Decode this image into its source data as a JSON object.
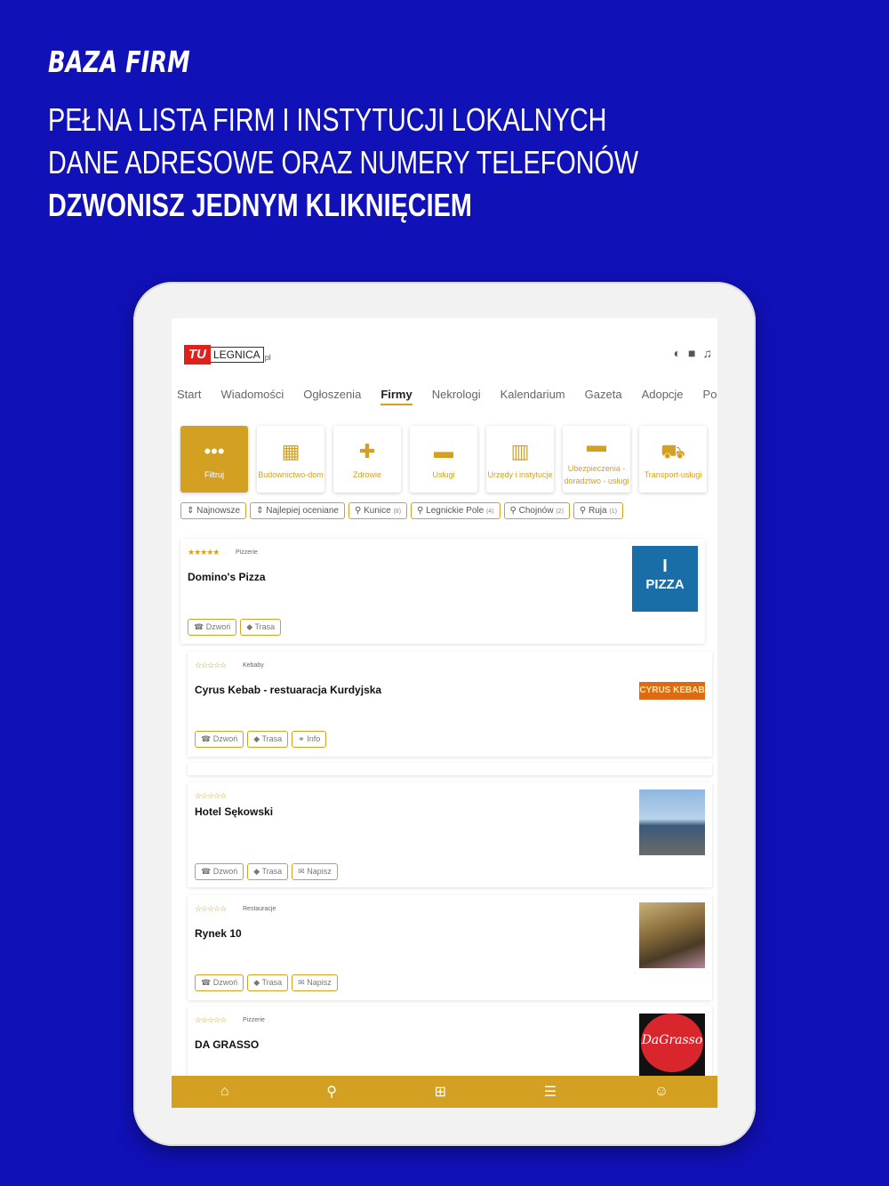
{
  "promo": {
    "title": "BAZA FIRM",
    "line1": "PEŁNA LISTA FIRM I INSTYTUCJI LOKALNYCH",
    "line2": "DANE ADRESOWE ORAZ NUMERY TELEFONÓW",
    "line3": "DZWONISZ JEDNYM KLIKNIĘCIEM"
  },
  "logo": {
    "tu": "TU",
    "name": "LEGNICA",
    "tld": "pl"
  },
  "nav": [
    "Start",
    "Wiadomości",
    "Ogłoszenia",
    "Firmy",
    "Nekrologi",
    "Kalendarium",
    "Gazeta",
    "Adopcje",
    "Pogoda"
  ],
  "categories": [
    {
      "label": "Filtruj",
      "icon": "more-icon"
    },
    {
      "label": "Budownictwo-dom",
      "icon": "building-icon"
    },
    {
      "label": "Zdrowie",
      "icon": "medkit-icon"
    },
    {
      "label": "Usługi",
      "icon": "briefcase-icon"
    },
    {
      "label": "Urzędy i instytucje",
      "icon": "city-icon"
    },
    {
      "label": "Ubezpieczenia - doradztwo - usługi",
      "icon": "briefcase-icon"
    },
    {
      "label": "Transport-usługi",
      "icon": "car-icon"
    }
  ],
  "chips": [
    {
      "label": "Najnowsze",
      "count": ""
    },
    {
      "label": "Najlepiej oceniane",
      "count": ""
    },
    {
      "label": "Kunice",
      "count": "(8)"
    },
    {
      "label": "Legnickie Pole",
      "count": "(4)"
    },
    {
      "label": "Chojnów",
      "count": "(2)"
    },
    {
      "label": "Ruja",
      "count": "(1)"
    }
  ],
  "listings": [
    {
      "name": "Domino's Pizza",
      "category": "Pizzerie",
      "stars": "★★★★★",
      "actions": [
        "Dzwoń",
        "Trasa"
      ]
    },
    {
      "name": "Cyrus Kebab - restuaracja Kurdyjska",
      "category": "Kebaby",
      "stars": "☆☆☆☆☆",
      "actions": [
        "Dzwoń",
        "Trasa",
        "Info"
      ]
    },
    {
      "name": "Hotel Sękowski",
      "category": "",
      "stars": "☆☆☆☆☆",
      "actions": [
        "Dzwoń",
        "Trasa",
        "Napisz"
      ]
    },
    {
      "name": "Rynek 10",
      "category": "Restauracje",
      "stars": "☆☆☆☆☆",
      "actions": [
        "Dzwoń",
        "Trasa",
        "Napisz"
      ]
    },
    {
      "name": "DA GRASSO",
      "category": "Pizzerie",
      "stars": "☆☆☆☆☆",
      "actions": []
    }
  ],
  "logos": {
    "pizza_i": "I",
    "pizza_word": "PIZZA",
    "cyrus": "CYRUS KEBAB",
    "dagrasso": "DaGrasso"
  },
  "colors": {
    "background": "#1111b8",
    "accent": "#d4a021"
  }
}
